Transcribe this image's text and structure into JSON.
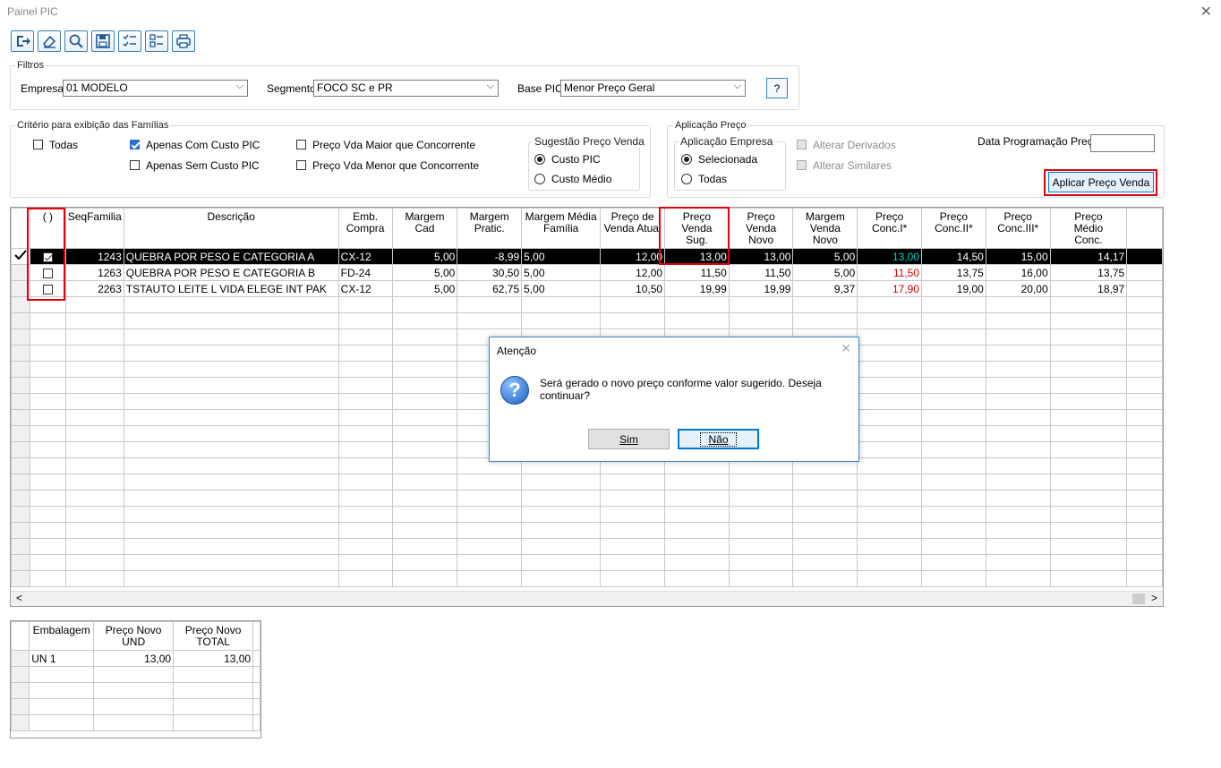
{
  "window": {
    "title": "Painel PIC",
    "close": "✕"
  },
  "toolbar": {
    "buttons": [
      "exit",
      "clear",
      "search",
      "save",
      "check-list",
      "uncheck-list",
      "print"
    ]
  },
  "filtros": {
    "label": "Filtros",
    "empresa_label": "Empresa",
    "empresa_value": "01 MODELO",
    "segmento_label": "Segmento",
    "segmento_value": "FOCO SC e PR",
    "base_label": "Base PIC",
    "base_value": "Menor Preço Geral",
    "help_label": "?"
  },
  "criterio": {
    "label": "Critério para exibição das Famílias",
    "todas": "Todas",
    "apenas_com": "Apenas Com Custo PIC",
    "apenas_sem": "Apenas Sem Custo PIC",
    "maior": "Preço Vda Maior que Concorrente",
    "menor": "Preço Vda Menor que Concorrente",
    "sugestao_label": "Sugestão Preço Venda",
    "custo_pic": "Custo PIC",
    "custo_medio": "Custo Médio"
  },
  "aplicacao": {
    "label": "Aplicação Preço",
    "empresa_label": "Aplicação Empresa",
    "selecionada": "Selecionada",
    "todas": "Todas",
    "alterar_derivados": "Alterar Derivados",
    "alterar_similares": "Alterar Similares",
    "data_label": "Data Programação Preço",
    "aplicar_button": "Aplicar Preço Venda"
  },
  "grid": {
    "headers": [
      "( )",
      "SeqFamilia",
      "Descrição",
      "Emb.\nCompra",
      "Margem\nCad",
      "Margem\nPratic.",
      "Margem Média\nFamília",
      "Preço de\nVenda Atual",
      "Preço\nVenda\nSug.",
      "Preço\nVenda\nNovo",
      "Margem\nVenda\nNovo",
      "Preço\nConc.I*",
      "Preço\nConc.II*",
      "Preço\nConc.III*",
      "Preço\nMédio\nConc."
    ],
    "rows": [
      {
        "checked": true,
        "selected": true,
        "seq": "1243",
        "desc": "QUEBRA POR PESO E CATEGORIA A",
        "emb": "CX-12",
        "mcad": "5,00",
        "mprat": "-8,99",
        "mmed": "5,00",
        "pvatual": "12,00",
        "pvsug": "13,00",
        "pvnovo": "13,00",
        "mvnovo": "5,00",
        "c1": "13,00",
        "c2": "14,50",
        "c3": "15,00",
        "cmed": "14,17",
        "c1color": "#00d0d0"
      },
      {
        "checked": false,
        "selected": false,
        "seq": "1263",
        "desc": "QUEBRA POR PESO E CATEGORIA B",
        "emb": "FD-24",
        "mcad": "5,00",
        "mprat": "30,50",
        "mmed": "5,00",
        "pvatual": "12,00",
        "pvsug": "11,50",
        "pvnovo": "11,50",
        "mvnovo": "5,00",
        "c1": "11,50",
        "c2": "13,75",
        "c3": "16,00",
        "cmed": "13,75",
        "c1color": "#d00000"
      },
      {
        "checked": false,
        "selected": false,
        "seq": "2263",
        "desc": "TSTAUTO  LEITE L VIDA ELEGE INT PAK",
        "emb": "CX-12",
        "mcad": "5,00",
        "mprat": "62,75",
        "mmed": "5,00",
        "pvatual": "10,50",
        "pvsug": "19,99",
        "pvnovo": "19,99",
        "mvnovo": "9,37",
        "c1": "17,90",
        "c2": "19,00",
        "c3": "20,00",
        "cmed": "18,97",
        "c1color": "#d00000"
      }
    ]
  },
  "dialog": {
    "title": "Atenção",
    "message": "Será gerado o novo preço conforme valor sugerido. Deseja continuar?",
    "yes": "Sim",
    "no": "Não"
  },
  "grid2": {
    "headers": [
      "Embalagem",
      "Preço Novo\nUND",
      "Preço Novo\nTOTAL"
    ],
    "rows": [
      {
        "emb": "UN 1",
        "und": "13,00",
        "total": "13,00"
      }
    ]
  }
}
